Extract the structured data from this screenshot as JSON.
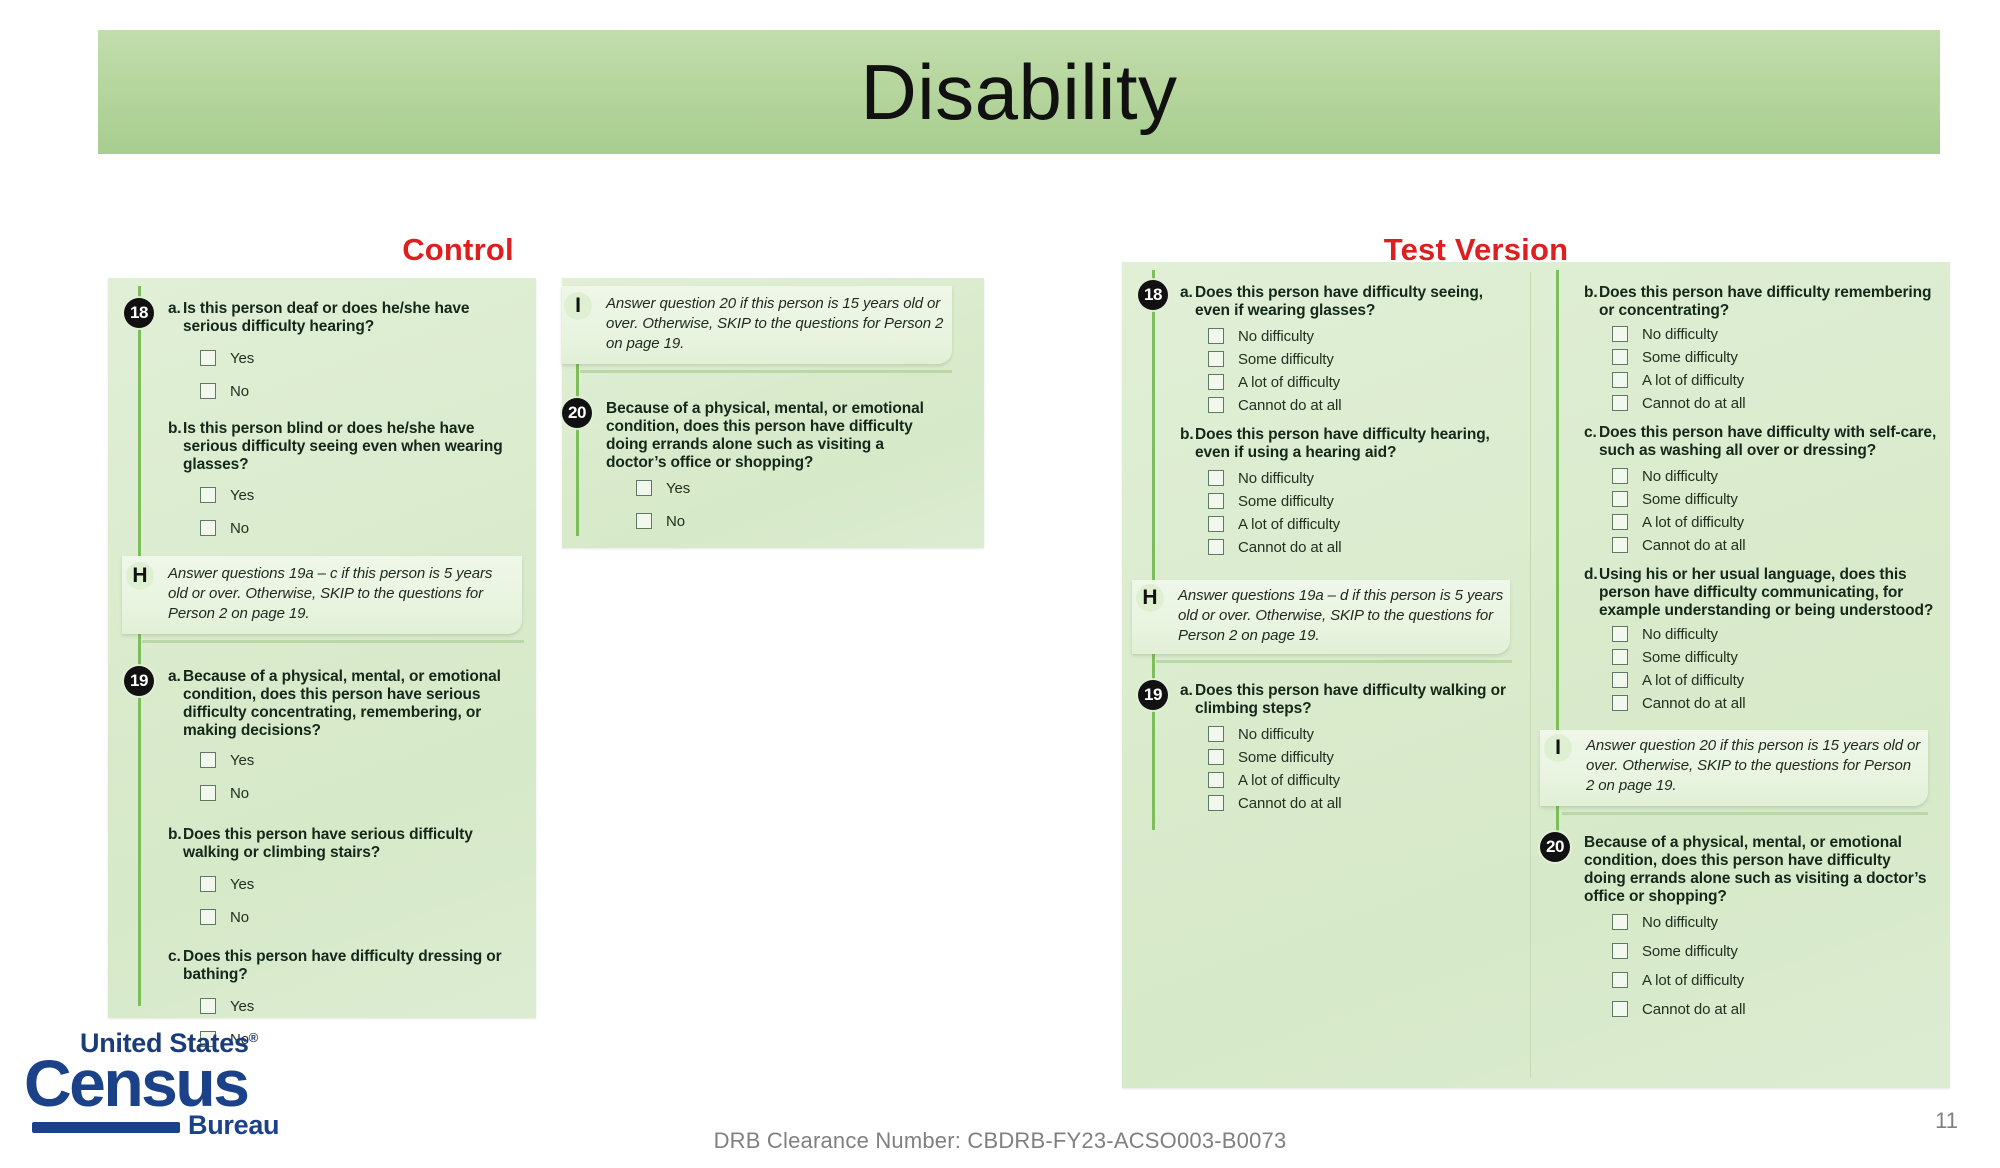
{
  "slide": {
    "title": "Disability",
    "page_number": "11",
    "footer": "DRB Clearance Number:  CBDRB-FY23-ACSO003-B0073"
  },
  "logo": {
    "line1": "United States",
    "registered_mark": "®",
    "line2": "Census",
    "line3": "Bureau"
  },
  "headers": {
    "control": "Control",
    "test": "Test Version",
    "accent_color": "#dd1f1f",
    "banner_color": "#b6d69e"
  },
  "control": {
    "q18": {
      "number": "18",
      "a": {
        "label": "a.",
        "text": "Is this person deaf or does he/she have serious difficulty hearing?",
        "options": [
          "Yes",
          "No"
        ]
      },
      "b": {
        "label": "b.",
        "text": "Is this person blind or does he/she have serious difficulty seeing even when wearing glasses?",
        "options": [
          "Yes",
          "No"
        ]
      }
    },
    "note_h": {
      "letter": "H",
      "text": "Answer questions 19a – c if this person is 5 years old or over. Otherwise, SKIP to the questions for Person 2 on page 19."
    },
    "q19": {
      "number": "19",
      "a": {
        "label": "a.",
        "text": "Because of a physical, mental, or emotional condition, does this person have serious difficulty concentrating, remembering, or making decisions?",
        "options": [
          "Yes",
          "No"
        ]
      },
      "b": {
        "label": "b.",
        "text": "Does this person have serious difficulty walking or climbing stairs?",
        "options": [
          "Yes",
          "No"
        ]
      },
      "c": {
        "label": "c.",
        "text": "Does this person have difficulty dressing or bathing?",
        "options": [
          "Yes",
          "No"
        ]
      }
    },
    "note_i": {
      "letter": "I",
      "text": "Answer question 20 if this person is 15 years old or over. Otherwise, SKIP to the questions for Person 2 on page 19."
    },
    "q20": {
      "number": "20",
      "text": "Because of a physical, mental, or emotional condition, does this person have difficulty doing errands alone such as visiting a doctor’s office or shopping?",
      "options": [
        "Yes",
        "No"
      ]
    }
  },
  "test": {
    "q18": {
      "number": "18",
      "a": {
        "label": "a.",
        "text": "Does this person have difficulty seeing, even if wearing glasses?",
        "options": [
          "No difficulty",
          "Some difficulty",
          "A lot of difficulty",
          "Cannot do at all"
        ]
      },
      "b": {
        "label": "b.",
        "text": "Does this person have difficulty hearing, even if using a hearing aid?",
        "options": [
          "No difficulty",
          "Some difficulty",
          "A lot of difficulty",
          "Cannot do at all"
        ]
      }
    },
    "note_h": {
      "letter": "H",
      "text": "Answer questions 19a – d if this person is 5 years old or over. Otherwise, SKIP to the questions for Person 2 on page 19."
    },
    "q19": {
      "number": "19",
      "a": {
        "label": "a.",
        "text": "Does this person have difficulty walking or climbing steps?",
        "options": [
          "No difficulty",
          "Some difficulty",
          "A lot of difficulty",
          "Cannot do at all"
        ]
      },
      "b": {
        "label": "b.",
        "text": "Does this person have difficulty remembering or concentrating?",
        "options": [
          "No difficulty",
          "Some difficulty",
          "A lot of difficulty",
          "Cannot do at all"
        ]
      },
      "c": {
        "label": "c.",
        "text": "Does this person have difficulty with self-care, such as washing all over or dressing?",
        "options": [
          "No difficulty",
          "Some difficulty",
          "A lot of difficulty",
          "Cannot do at all"
        ]
      },
      "d": {
        "label": "d.",
        "text": "Using his or her usual language, does this person have difficulty communicating, for example understanding or being understood?",
        "options": [
          "No difficulty",
          "Some difficulty",
          "A lot of difficulty",
          "Cannot do at all"
        ]
      }
    },
    "note_i": {
      "letter": "I",
      "text": "Answer question 20 if this person is 15 years old or over. Otherwise, SKIP to the questions for Person 2 on page 19."
    },
    "q20": {
      "number": "20",
      "text": "Because of a physical, mental, or emotional condition, does this person have difficulty doing errands alone such as visiting a doctor’s office or shopping?",
      "options": [
        "No difficulty",
        "Some difficulty",
        "A lot of difficulty",
        "Cannot do at all"
      ]
    }
  }
}
